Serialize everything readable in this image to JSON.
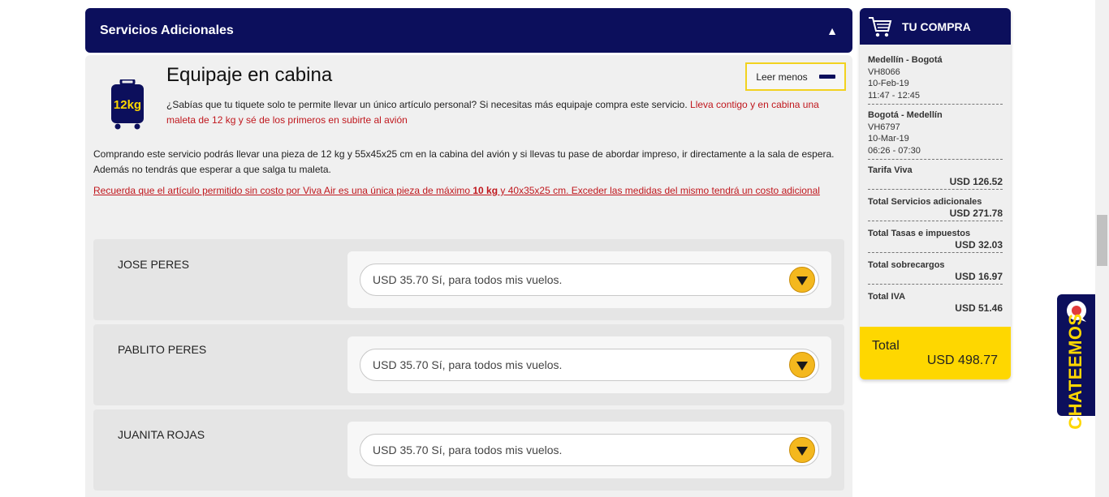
{
  "section": {
    "title": "Servicios Adicionales",
    "toggle_icon": "▲"
  },
  "baggage": {
    "badge_text": "12kg",
    "title": "Equipaje en cabina",
    "read_less": "Leer menos",
    "intro_text": "¿Sabías que tu tiquete solo te permite llevar un único artículo personal? Si necesitas más equipaje compra este servicio. ",
    "intro_highlight": "Lleva contigo y en cabina una maleta de 12 kg y sé de los primeros en subirte al avión",
    "description": "Comprando este servicio podrás llevar una pieza de 12 kg y 55x45x25 cm en la cabina del avión y si llevas tu pase de abordar impreso, ir directamente a la sala de espera. Además no tendrás que esperar a que salga tu maleta.",
    "notice_part1": "Recuerda que el artículo permitido sin costo por Viva Air es una única pieza de máximo ",
    "notice_bold": "10 kg",
    "notice_part2": " y 40x35x25 cm. Exceder las medidas del mismo tendrá un costo adicional"
  },
  "passengers": [
    {
      "name": "JOSE PERES",
      "selection": "USD 35.70 Sí, para todos mis vuelos."
    },
    {
      "name": "PABLITO PERES",
      "selection": "USD 35.70 Sí, para todos mis vuelos."
    },
    {
      "name": "JUANITA ROJAS",
      "selection": "USD 35.70 Sí, para todos mis vuelos."
    }
  ],
  "cart": {
    "title": "TU COMPRA",
    "flights": [
      {
        "route": "Medellín - Bogotá",
        "code": "VH8066",
        "date": "10-Feb-19",
        "time": "11:47 - 12:45"
      },
      {
        "route": "Bogotá - Medellín",
        "code": "VH6797",
        "date": "10-Mar-19",
        "time": "06:26 - 07:30"
      }
    ],
    "items": [
      {
        "label": "Tarifa Viva",
        "amount": "USD 126.52"
      },
      {
        "label": "Total Servicios adicionales",
        "amount": "USD 271.78"
      },
      {
        "label": "Total Tasas e impuestos",
        "amount": "USD 32.03"
      },
      {
        "label": "Total sobrecargos",
        "amount": "USD 16.97"
      },
      {
        "label": "Total IVA",
        "amount": "USD 51.46"
      }
    ],
    "total_label": "Total",
    "total_amount": "USD 498.77"
  },
  "chat": {
    "label": "CHATEEMOS"
  },
  "colors": {
    "navy": "#0c0f5c",
    "yellow": "#fed700",
    "red": "#c0171d",
    "dropdown": "#f4b81e"
  }
}
